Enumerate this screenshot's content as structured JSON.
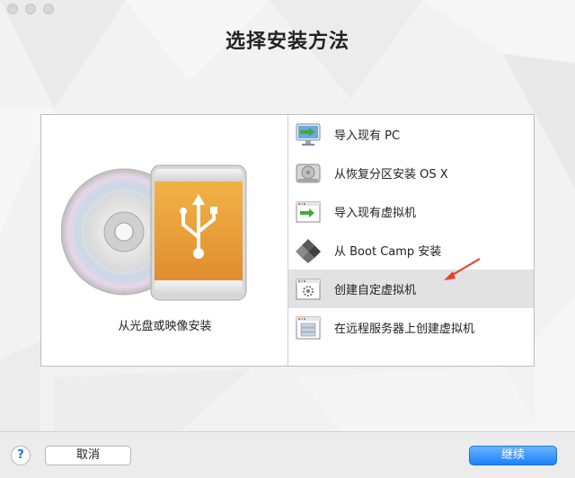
{
  "window": {
    "title": "选择安装方法"
  },
  "left_pane": {
    "label": "从光盘或映像安装"
  },
  "options": [
    {
      "label": "导入现有 PC",
      "icon": "monitor-import-icon"
    },
    {
      "label": "从恢复分区安装 OS X",
      "icon": "hard-drive-icon"
    },
    {
      "label": "导入现有虚拟机",
      "icon": "vm-import-icon"
    },
    {
      "label": "从 Boot Camp 安装",
      "icon": "boot-camp-icon"
    },
    {
      "label": "创建自定虚拟机",
      "icon": "custom-vm-icon"
    },
    {
      "label": "在远程服务器上创建虚拟机",
      "icon": "remote-server-icon"
    }
  ],
  "selected_index": 4,
  "footer": {
    "help_label": "?",
    "cancel_label": "取消",
    "continue_label": "继续"
  },
  "colors": {
    "accent": "#1a82fb",
    "annotation_arrow": "#e8402c",
    "selection": "#e2e2e2"
  }
}
